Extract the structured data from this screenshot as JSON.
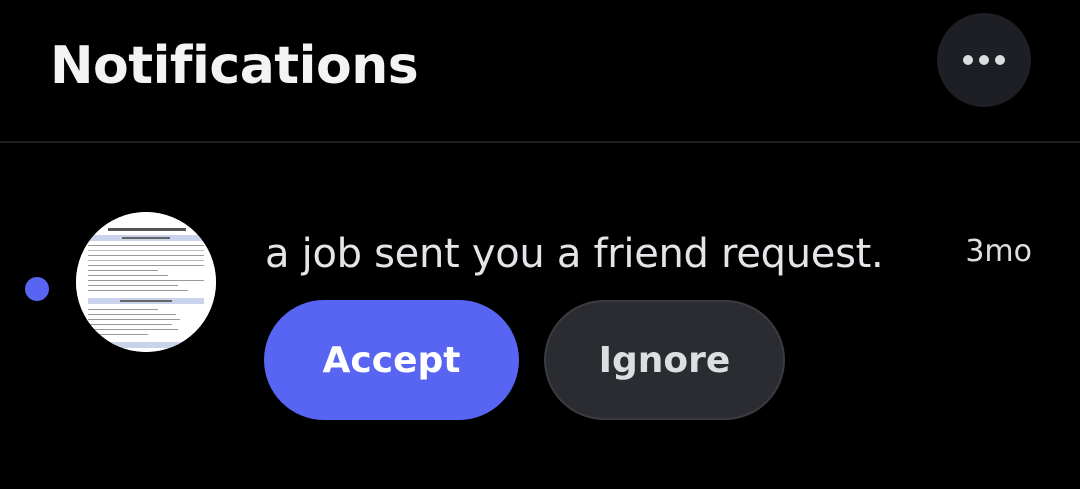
{
  "header": {
    "title": "Notifications",
    "more_icon": "more-horizontal-icon"
  },
  "notifications": [
    {
      "unread": true,
      "avatar_description": "employment-application-form-thumbnail",
      "message": "a job sent you a friend request.",
      "time": "3mo",
      "actions": {
        "accept_label": "Accept",
        "ignore_label": "Ignore"
      }
    }
  ],
  "colors": {
    "background": "#000000",
    "accent": "#5865f2",
    "text_primary": "#f2f3f5",
    "button_secondary": "#2b2c31"
  },
  "avatar_image_text": {
    "form_title": "EMPLOYMENT / JOB APPLICATION",
    "section_1": "PERSONAL INFORMATION",
    "section_2": "EMPLOYMENT ELIGIBILITY",
    "section_3": "EDUCATION"
  }
}
